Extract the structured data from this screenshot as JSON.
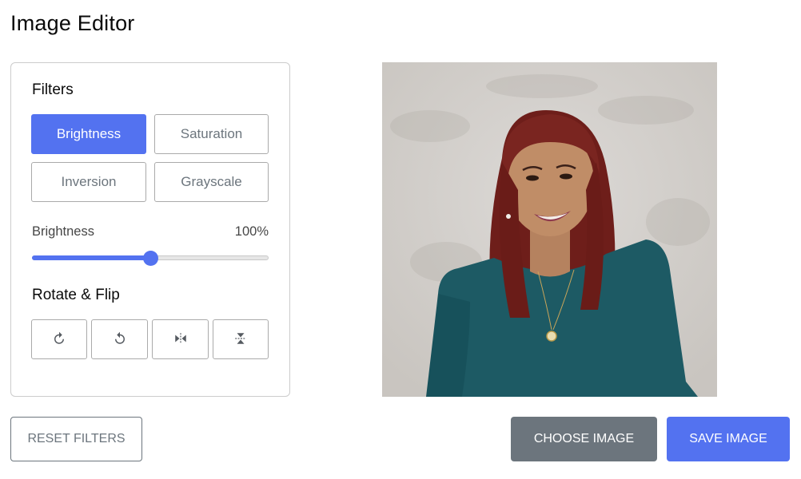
{
  "app": {
    "title": "Image Editor"
  },
  "filters": {
    "title": "Filters",
    "options": [
      {
        "label": "Brightness",
        "active": true
      },
      {
        "label": "Saturation",
        "active": false
      },
      {
        "label": "Inversion",
        "active": false
      },
      {
        "label": "Grayscale",
        "active": false
      }
    ],
    "slider": {
      "label": "Brightness",
      "value_text": "100%",
      "value": 100,
      "min": 0,
      "max": 200
    }
  },
  "rotate_flip": {
    "title": "Rotate & Flip",
    "buttons": [
      {
        "icon": "rotate-left-icon"
      },
      {
        "icon": "rotate-right-icon"
      },
      {
        "icon": "flip-horizontal-icon"
      },
      {
        "icon": "flip-vertical-icon"
      }
    ]
  },
  "preview": {
    "alt": "Portrait of a smiling woman with long red hair wearing a teal top against a textured gray background"
  },
  "actions": {
    "reset_label": "Reset Filters",
    "choose_label": "Choose Image",
    "save_label": "Save Image"
  },
  "colors": {
    "accent": "#5372F0",
    "secondary": "#6C757D",
    "border": "#CCCCCC"
  }
}
